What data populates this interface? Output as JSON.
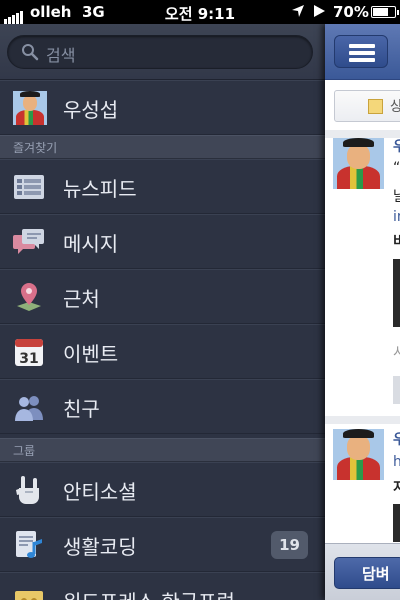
{
  "status_bar": {
    "carrier": "olleh",
    "network": "3G",
    "time": "오전 9:11",
    "battery_percent": "70%",
    "battery_level": 0.7
  },
  "sidebar": {
    "search": {
      "placeholder": "검색"
    },
    "profile": {
      "name": "우성섭"
    },
    "favorites_header": "즐겨찾기",
    "favorites": [
      {
        "label": "뉴스피드",
        "icon": "news-feed-icon"
      },
      {
        "label": "메시지",
        "icon": "messages-icon"
      },
      {
        "label": "근처",
        "icon": "nearby-pin-icon"
      },
      {
        "label": "이벤트",
        "icon": "calendar-icon",
        "icon_text": "31"
      },
      {
        "label": "친구",
        "icon": "friends-icon"
      }
    ],
    "groups_header": "그룹",
    "groups": [
      {
        "label": "안티소셜",
        "icon": "rock-hand-icon"
      },
      {
        "label": "생활코딩",
        "icon": "music-doc-icon",
        "badge": "19"
      },
      {
        "label": "워드프레스 한국포럼",
        "icon": "group-folder-icon"
      }
    ]
  },
  "feed": {
    "status_button": "상",
    "post1": {
      "name_frag": "우",
      "line1": "“",
      "line2": "날",
      "line3": "in",
      "line4": "비",
      "line5": "시"
    },
    "post2": {
      "name_frag": "우",
      "line1": "h",
      "line2": "지"
    },
    "reply_button": "담벼"
  },
  "colors": {
    "sidebar_bg": "#2d3343",
    "section_header_bg": "#404656",
    "facebook_blue": "#3b5998",
    "badge_bg": "#525a6b"
  }
}
